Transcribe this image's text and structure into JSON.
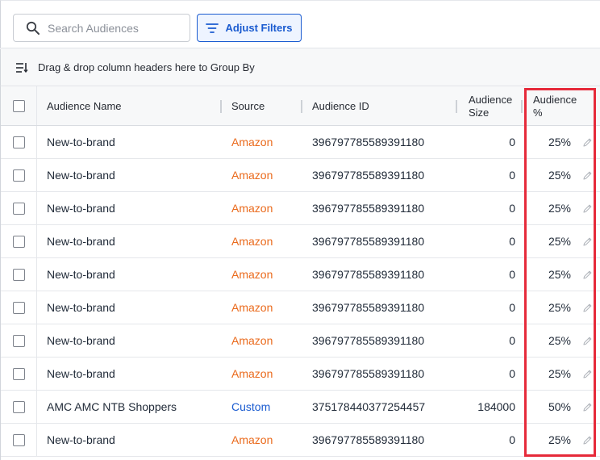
{
  "search": {
    "placeholder": "Search Audiences",
    "icon": "search-icon"
  },
  "filters": {
    "label": "Adjust Filters",
    "icon": "filter-icon",
    "accent": "#1a5bd0"
  },
  "group_by": {
    "label": "Drag & drop column headers here to Group By",
    "icon": "group-by-icon"
  },
  "columns": {
    "name": "Audience Name",
    "source": "Source",
    "id": "Audience ID",
    "size_line1": "Audience",
    "size_line2": "Size",
    "pct_line1": "Audience",
    "pct_line2": "%"
  },
  "colors": {
    "amazon": "#ea6a1c",
    "custom": "#1a5bd0",
    "highlight": "#e62a3a"
  },
  "rows": [
    {
      "name": "New-to-brand",
      "source": "Amazon",
      "id": "396797785589391180",
      "size": "0",
      "pct": "25%"
    },
    {
      "name": "New-to-brand",
      "source": "Amazon",
      "id": "396797785589391180",
      "size": "0",
      "pct": "25%"
    },
    {
      "name": "New-to-brand",
      "source": "Amazon",
      "id": "396797785589391180",
      "size": "0",
      "pct": "25%"
    },
    {
      "name": "New-to-brand",
      "source": "Amazon",
      "id": "396797785589391180",
      "size": "0",
      "pct": "25%"
    },
    {
      "name": "New-to-brand",
      "source": "Amazon",
      "id": "396797785589391180",
      "size": "0",
      "pct": "25%"
    },
    {
      "name": "New-to-brand",
      "source": "Amazon",
      "id": "396797785589391180",
      "size": "0",
      "pct": "25%"
    },
    {
      "name": "New-to-brand",
      "source": "Amazon",
      "id": "396797785589391180",
      "size": "0",
      "pct": "25%"
    },
    {
      "name": "New-to-brand",
      "source": "Amazon",
      "id": "396797785589391180",
      "size": "0",
      "pct": "25%"
    },
    {
      "name": "AMC AMC NTB Shoppers",
      "source": "Custom",
      "id": "375178440377254457",
      "size": "184000",
      "pct": "50%"
    },
    {
      "name": "New-to-brand",
      "source": "Amazon",
      "id": "396797785589391180",
      "size": "0",
      "pct": "25%"
    }
  ]
}
